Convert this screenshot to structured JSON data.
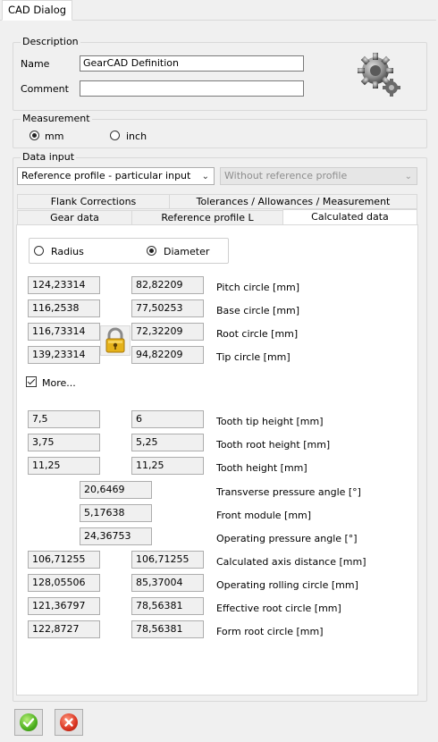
{
  "window": {
    "tab_title": "CAD Dialog"
  },
  "description": {
    "group_title": "Description",
    "name_label": "Name",
    "name_value": "GearCAD Definition",
    "comment_label": "Comment",
    "comment_value": ""
  },
  "measurement": {
    "group_title": "Measurement",
    "mm_label": "mm",
    "inch_label": "inch",
    "selected": "mm"
  },
  "data_input": {
    "group_title": "Data input",
    "profile_select": "Reference profile - particular input",
    "secondary_select": "Without reference profile",
    "tabs_row1": [
      "Flank Corrections",
      "Tolerances / Allowances / Measurement"
    ],
    "tabs_row2": [
      "Gear data",
      "Reference profile L",
      "Calculated data"
    ],
    "active_tab": "Calculated data"
  },
  "calc": {
    "radius_label": "Radius",
    "diameter_label": "Diameter",
    "selected": "Diameter",
    "more_label": "More...",
    "more_checked": true,
    "rows_top": [
      {
        "v1": "124,23314",
        "v2": "82,82209",
        "label": "Pitch circle [mm]"
      },
      {
        "v1": "116,2538",
        "v2": "77,50253",
        "label": "Base circle [mm]"
      },
      {
        "v1": "116,73314",
        "v2": "72,32209",
        "label": "Root circle [mm]"
      },
      {
        "v1": "139,23314",
        "v2": "94,82209",
        "label": "Tip circle [mm]"
      }
    ],
    "rows_pair1": [
      {
        "v1": "7,5",
        "v2": "6",
        "label": "Tooth tip height [mm]"
      },
      {
        "v1": "3,75",
        "v2": "5,25",
        "label": "Tooth root height [mm]"
      },
      {
        "v1": "11,25",
        "v2": "11,25",
        "label": "Tooth height [mm]"
      }
    ],
    "rows_single": [
      {
        "v": "20,6469",
        "label": "Transverse pressure angle [°]"
      },
      {
        "v": "5,17638",
        "label": "Front module [mm]"
      },
      {
        "v": "24,36753",
        "label": "Operating pressure angle [°]"
      }
    ],
    "rows_pair2": [
      {
        "v1": "106,71255",
        "v2": "106,71255",
        "label": "Calculated axis distance [mm]"
      },
      {
        "v1": "128,05506",
        "v2": "85,37004",
        "label": "Operating rolling circle [mm]"
      },
      {
        "v1": "121,36797",
        "v2": "78,56381",
        "label": "Effective root circle [mm]"
      },
      {
        "v1": "122,8727",
        "v2": "78,56381",
        "label": "Form root circle [mm]"
      }
    ]
  },
  "buttons": {
    "ok_icon": "check-icon",
    "cancel_icon": "close-icon",
    "ok_color": "#4caf1e",
    "cancel_color": "#d9321f"
  }
}
